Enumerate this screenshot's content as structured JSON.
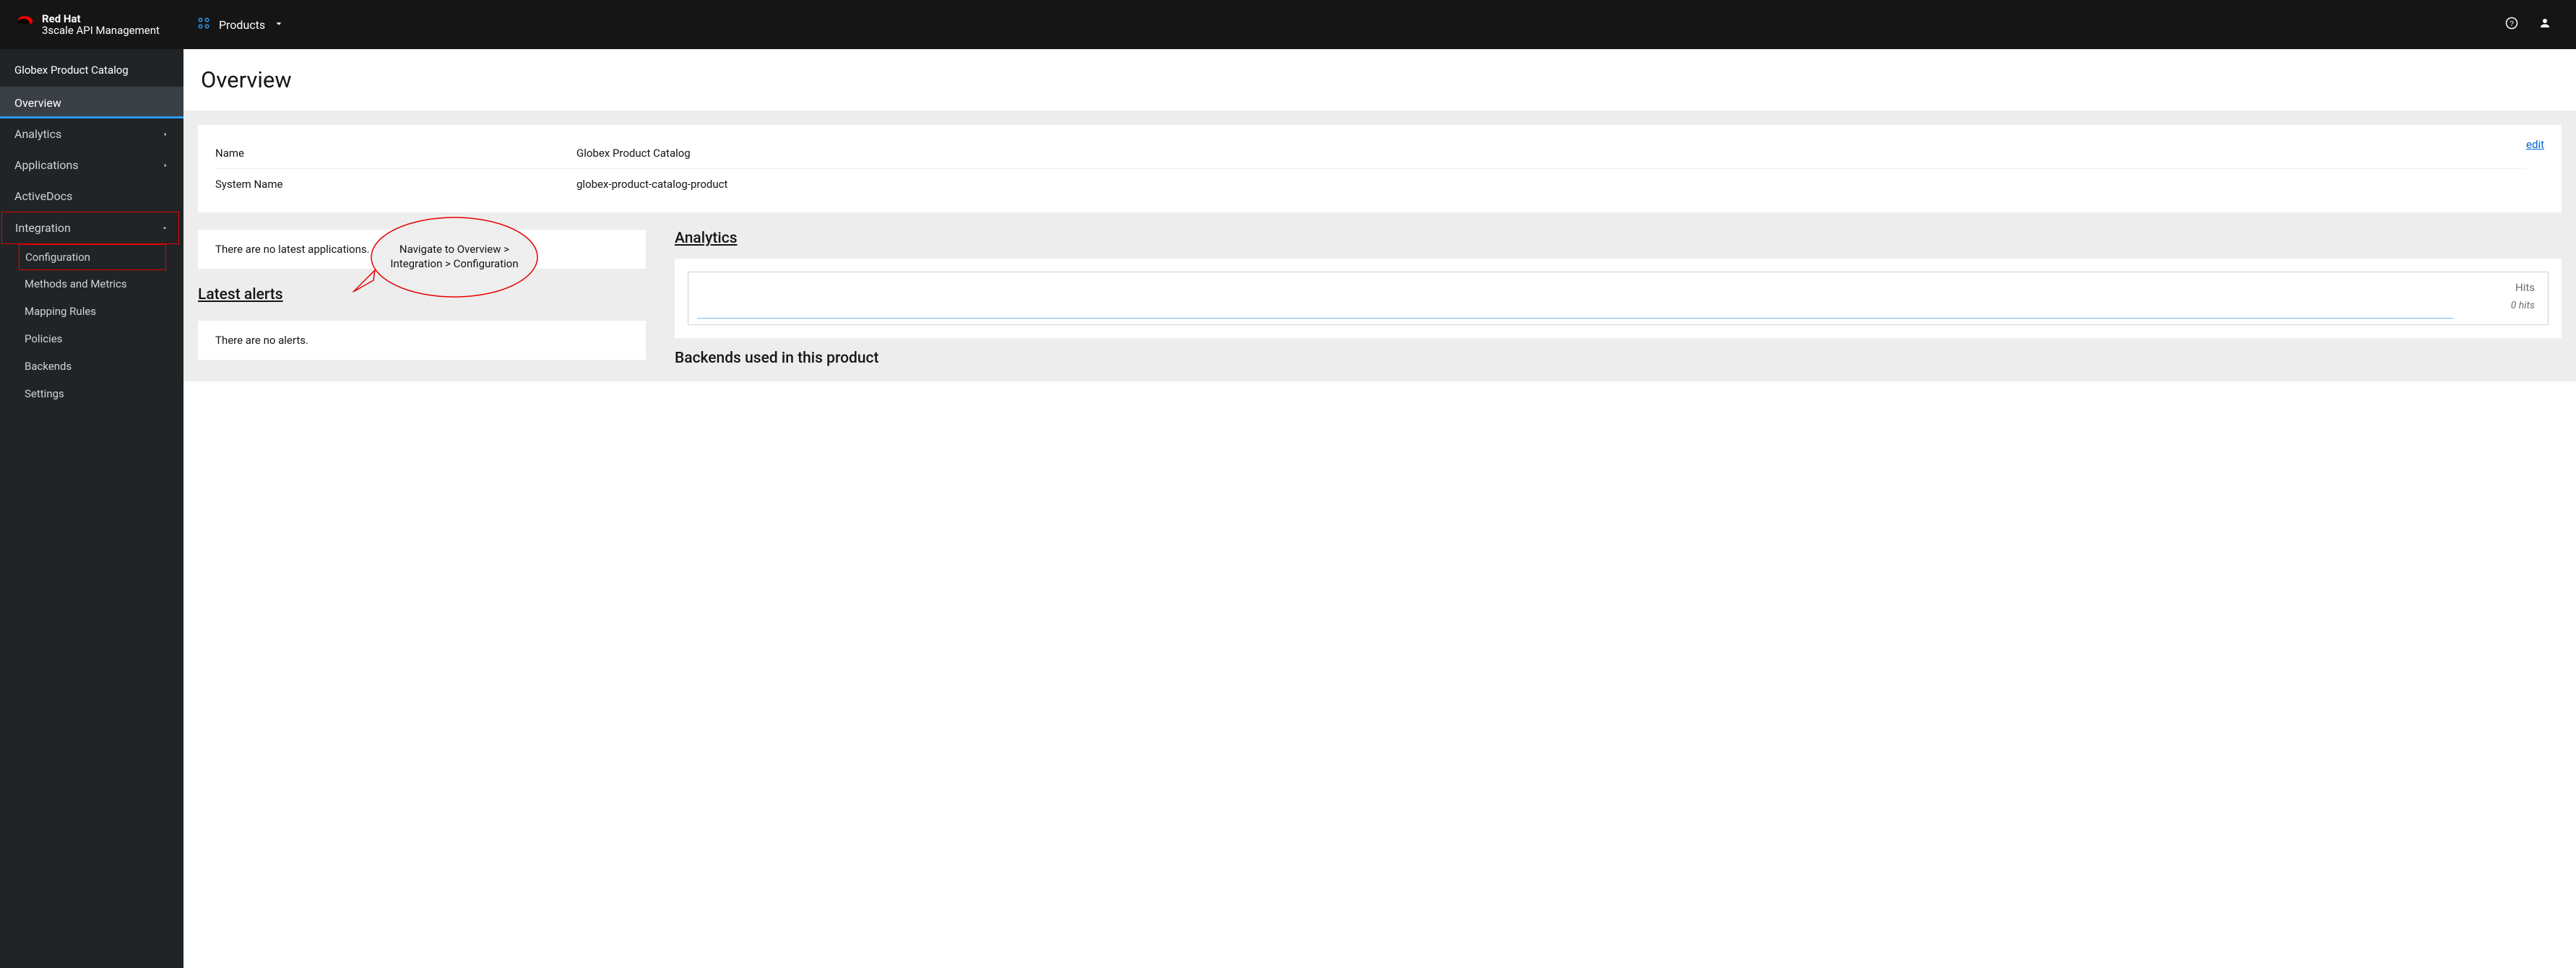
{
  "brand": {
    "title": "Red Hat",
    "subtitle": "3scale API Management"
  },
  "topnav": {
    "products_label": "Products"
  },
  "sidebar": {
    "context": "Globex Product Catalog",
    "overview": "Overview",
    "analytics": "Analytics",
    "applications": "Applications",
    "activedocs": "ActiveDocs",
    "integration": "Integration",
    "sub_configuration": "Configuration",
    "sub_methods": "Methods and Metrics",
    "sub_mapping": "Mapping Rules",
    "sub_policies": "Policies",
    "sub_backends": "Backends",
    "sub_settings": "Settings"
  },
  "page": {
    "title": "Overview",
    "edit": "edit",
    "name_label": "Name",
    "name_value": "Globex Product Catalog",
    "sysname_label": "System Name",
    "sysname_value": "globex-product-catalog-product",
    "no_apps": "There are no latest applications.",
    "latest_alerts": "Latest alerts",
    "no_alerts": "There are no alerts.",
    "analytics_heading": "Analytics",
    "hits_label": "Hits",
    "hits_value": "0 hits",
    "backends_heading": "Backends used in this product"
  },
  "callout": {
    "line1": "Navigate to Overview >",
    "line2": "Integration > Configuration"
  }
}
